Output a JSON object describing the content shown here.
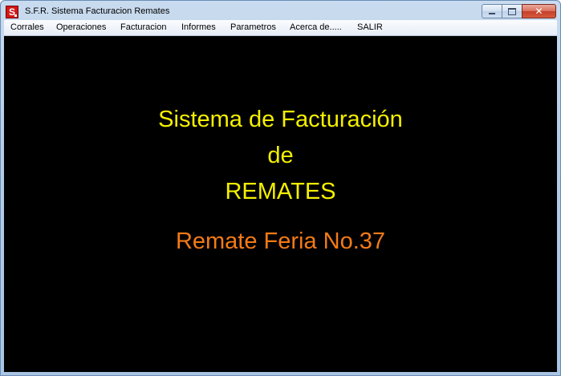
{
  "window": {
    "title": "S.F.R. Sistema Facturacion Remates",
    "icon_letter": "S",
    "controls": {
      "minimize": "minimize-icon",
      "maximize": "maximize-icon",
      "close": "close-icon",
      "close_glyph": "✕"
    }
  },
  "menu": {
    "items": [
      {
        "label": "Corrales"
      },
      {
        "label": "Operaciones"
      },
      {
        "label": "Facturacion"
      },
      {
        "label": "Informes"
      },
      {
        "label": "Parametros"
      },
      {
        "label": "Acerca de....."
      },
      {
        "label": "SALIR"
      }
    ]
  },
  "splash": {
    "line1": "Sistema de Facturación",
    "line2": "de",
    "line3": "REMATES",
    "subtitle": "Remate Feria No.37"
  },
  "colors": {
    "background": "#000000",
    "headline": "#f4f000",
    "subtitle": "#f47a16"
  }
}
